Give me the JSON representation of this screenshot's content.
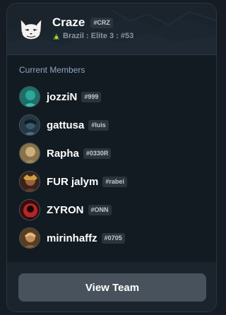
{
  "team": {
    "name": "Craze",
    "tag": "#CRZ",
    "region_line": "Brazil : Elite 3 : #53",
    "logo_icon": "cat-logo-icon",
    "flag_icon": "brazil-flag-icon"
  },
  "members_section": {
    "title": "Current Members",
    "members": [
      {
        "name": "jozziN",
        "tag": "#999",
        "avatar_color": "#2aa89a"
      },
      {
        "name": "gattusa",
        "tag": "#luis",
        "avatar_color": "#3a5a6e"
      },
      {
        "name": "Rapha",
        "tag": "#0330R",
        "avatar_color": "#b8a070"
      },
      {
        "name": "FUR jalym",
        "tag": "#rabei",
        "avatar_color": "#7a4a30"
      },
      {
        "name": "ZYRON",
        "tag": "#ONN",
        "avatar_color": "#b02828"
      },
      {
        "name": "mirinhaffz",
        "tag": "#0705",
        "avatar_color": "#a07850"
      }
    ]
  },
  "footer": {
    "view_button_label": "View Team"
  },
  "colors": {
    "background": "#151c23",
    "card": "#131b22",
    "button": "#48525c",
    "section_title": "#8fa4c2"
  }
}
